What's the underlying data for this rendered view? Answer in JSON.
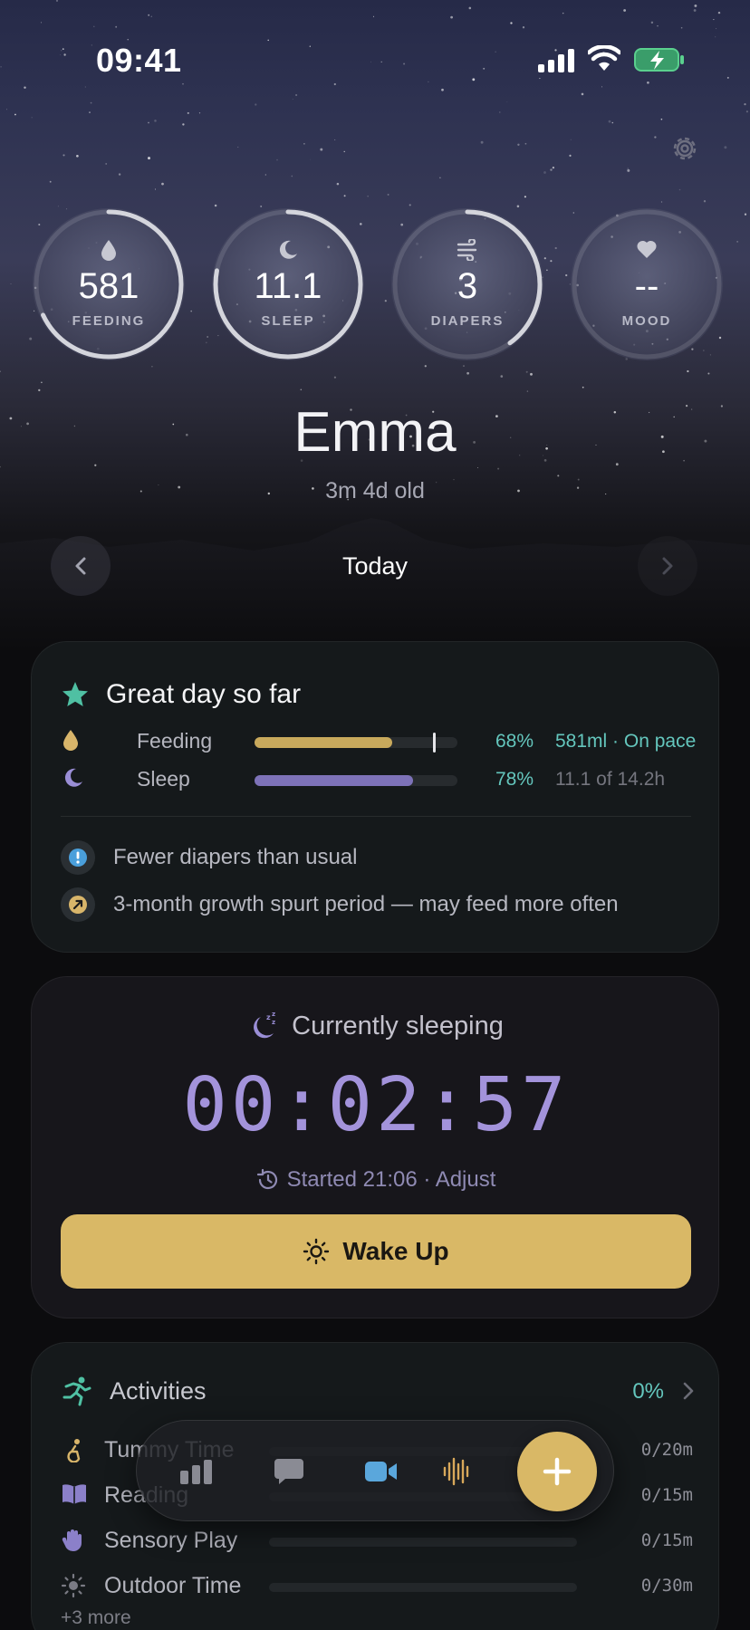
{
  "status_bar": {
    "time": "09:41"
  },
  "stats": [
    {
      "value": "581",
      "label": "FEEDING",
      "progress": 0.68,
      "icon": "drop-icon"
    },
    {
      "value": "11.1",
      "label": "SLEEP",
      "progress": 0.78,
      "icon": "moon-icon"
    },
    {
      "value": "3",
      "label": "DIAPERS",
      "progress": 0.4,
      "icon": "wind-icon"
    },
    {
      "value": "--",
      "label": "MOOD",
      "progress": 0,
      "icon": "heart-icon"
    }
  ],
  "profile": {
    "name": "Emma",
    "age": "3m 4d old"
  },
  "date_nav": {
    "label": "Today"
  },
  "summary": {
    "title": "Great day so far",
    "metrics": [
      {
        "label": "Feeding",
        "percent": "68%",
        "detail": "581ml · On pace",
        "fill": 0.68,
        "target": 0.88,
        "color": "#c8a95c",
        "detail_color": "#64c6bd"
      },
      {
        "label": "Sleep",
        "percent": "78%",
        "detail": "11.1 of 14.2h",
        "fill": 0.78,
        "color": "#7d72b8",
        "detail_color": "#74757e"
      }
    ],
    "insights": [
      {
        "text": "Fewer diapers than usual",
        "icon": "info-icon"
      },
      {
        "text": "3-month growth spurt period — may feed more often",
        "icon": "trend-up-icon"
      }
    ]
  },
  "sleeping": {
    "title": "Currently sleeping",
    "timer": "00:02:57",
    "started": "Started 21:06 · Adjust",
    "button": "Wake Up"
  },
  "activities": {
    "title": "Activities",
    "percent": "0%",
    "items": [
      {
        "label": "Tummy Time",
        "value": "0/20m",
        "icon": "tummy-icon"
      },
      {
        "label": "Reading",
        "value": "0/15m",
        "icon": "book-icon"
      },
      {
        "label": "Sensory Play",
        "value": "0/15m",
        "icon": "hand-icon"
      },
      {
        "label": "Outdoor Time",
        "value": "0/30m",
        "icon": "sun-icon"
      }
    ],
    "more": "+3 more"
  },
  "colors": {
    "accent_gold": "#d9b866",
    "accent_teal": "#64c6bd",
    "accent_purple": "#a393db"
  }
}
